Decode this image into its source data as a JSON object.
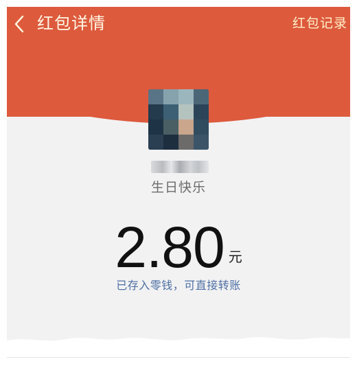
{
  "header": {
    "back_icon": "chevron-left-icon",
    "title": "红包详情",
    "right_link": "红包记录"
  },
  "sender": {
    "avatar": "blurred-avatar-image",
    "name": "",
    "greeting": "生日快乐"
  },
  "amount": {
    "value": "2.80",
    "unit": "元"
  },
  "status": {
    "text": "已存入零钱，可直接转账"
  },
  "colors": {
    "header_red": "#dd5a3d",
    "title_text": "#fff8e6",
    "link_blue": "#4e6fa3",
    "background": "#f2f2f3"
  }
}
